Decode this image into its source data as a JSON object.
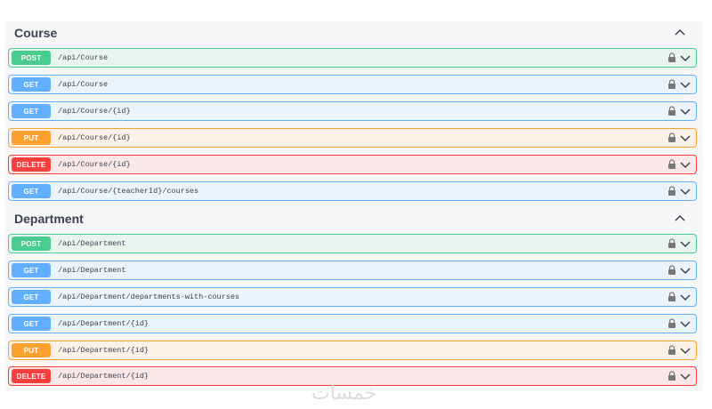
{
  "sections": [
    {
      "title": "Course",
      "operations": [
        {
          "method": "POST",
          "path": "/api/Course"
        },
        {
          "method": "GET",
          "path": "/api/Course"
        },
        {
          "method": "GET",
          "path": "/api/Course/{id}"
        },
        {
          "method": "PUT",
          "path": "/api/Course/{id}"
        },
        {
          "method": "DELETE",
          "path": "/api/Course/{id}"
        },
        {
          "method": "GET",
          "path": "/api/Course/{teacherId}/courses"
        }
      ]
    },
    {
      "title": "Department",
      "operations": [
        {
          "method": "POST",
          "path": "/api/Department"
        },
        {
          "method": "GET",
          "path": "/api/Department"
        },
        {
          "method": "GET",
          "path": "/api/Department/departments-with-courses"
        },
        {
          "method": "GET",
          "path": "/api/Department/{id}"
        },
        {
          "method": "PUT",
          "path": "/api/Department/{id}"
        },
        {
          "method": "DELETE",
          "path": "/api/Department/{id}"
        }
      ]
    }
  ],
  "icons": {
    "collapse": "chevron-up-icon",
    "lock": "lock-icon",
    "expand": "chevron-down-icon"
  },
  "colors": {
    "post": "#49cc90",
    "get": "#61affe",
    "put": "#fca130",
    "delete": "#f93e3e",
    "text": "#3b4151"
  },
  "watermark": "خمسات"
}
